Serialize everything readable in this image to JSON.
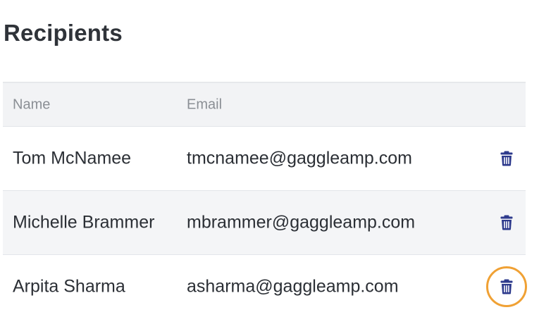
{
  "page": {
    "title": "Recipients"
  },
  "table": {
    "columns": {
      "name": "Name",
      "email": "Email"
    },
    "rows": [
      {
        "name": "Tom McNamee",
        "email": "tmcnamee@gaggleamp.com",
        "action_icon": "trash-icon",
        "highlighted": false
      },
      {
        "name": "Michelle Brammer",
        "email": "mbrammer@gaggleamp.com",
        "action_icon": "trash-icon",
        "highlighted": false
      },
      {
        "name": "Arpita Sharma",
        "email": "asharma@gaggleamp.com",
        "action_icon": "trash-icon",
        "highlighted": true
      }
    ]
  },
  "colors": {
    "icon": "#2d3a8c",
    "highlight_ring": "#f0a134",
    "header_bg": "#f2f3f5",
    "shaded_row_bg": "#f4f5f7"
  }
}
